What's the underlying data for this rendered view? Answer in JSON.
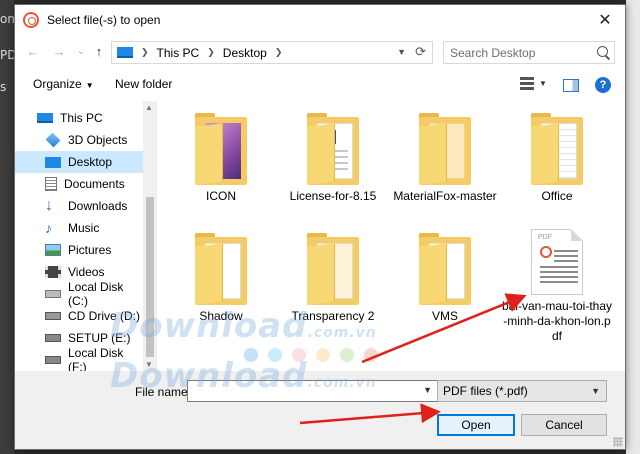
{
  "background": {
    "side_texts": [
      "om",
      "PD",
      "s"
    ]
  },
  "dialog": {
    "title": "Select file(-s) to open",
    "close_glyph": "✕",
    "nav": {
      "back": "←",
      "forward": "→",
      "recent": "⌄",
      "up": "↑"
    },
    "address": {
      "crumbs": [
        "This PC",
        "Desktop"
      ]
    },
    "search": {
      "placeholder": "Search Desktop"
    },
    "toolbar": {
      "organize": "Organize",
      "new_folder": "New folder",
      "help": "?"
    },
    "nav_pane": [
      {
        "label": "This PC",
        "icon": "pc-icon",
        "selected": false
      },
      {
        "label": "3D Objects",
        "icon": "cube-icon",
        "selected": false
      },
      {
        "label": "Desktop",
        "icon": "desktop-icon",
        "selected": true
      },
      {
        "label": "Documents",
        "icon": "document-icon",
        "selected": false
      },
      {
        "label": "Downloads",
        "icon": "download-icon",
        "selected": false
      },
      {
        "label": "Music",
        "icon": "music-icon",
        "selected": false
      },
      {
        "label": "Pictures",
        "icon": "picture-icon",
        "selected": false
      },
      {
        "label": "Videos",
        "icon": "video-icon",
        "selected": false
      },
      {
        "label": "Local Disk (C:)",
        "icon": "disk-icon",
        "selected": false
      },
      {
        "label": "CD Drive (D:)",
        "icon": "cd-icon",
        "selected": false
      },
      {
        "label": "SETUP (E:)",
        "icon": "disk-icon",
        "selected": false
      },
      {
        "label": "Local Disk (F:)",
        "icon": "disk-icon",
        "selected": false
      }
    ],
    "files": [
      {
        "name": "ICON",
        "type": "folder",
        "variant": "purple"
      },
      {
        "name": "License-for-8.15",
        "type": "folder",
        "variant": "word"
      },
      {
        "name": "MaterialFox-master",
        "type": "folder",
        "variant": "plain"
      },
      {
        "name": "Office",
        "type": "folder",
        "variant": "office"
      },
      {
        "name": "Shadow",
        "type": "folder",
        "variant": "plain"
      },
      {
        "name": "Transparency 2",
        "type": "folder",
        "variant": "plain"
      },
      {
        "name": "VMS",
        "type": "folder",
        "variant": "plain"
      },
      {
        "name": "bai-van-mau-toi-thay-minh-da-khon-lon.pdf",
        "type": "pdf",
        "tag": "PDF"
      }
    ],
    "bottom": {
      "file_name_label": "File name:",
      "file_name_value": "",
      "file_type": "PDF files (*.pdf)",
      "open_label": "Open",
      "cancel_label": "Cancel"
    }
  },
  "watermark": {
    "text": "Download",
    "suffix": ".com.vn"
  },
  "colors": {
    "accent": "#0078d7",
    "selection": "#cce8ff",
    "folder": "#f4cb64",
    "arrow": "#e0201b",
    "pdf_logo": "#e2553b"
  }
}
